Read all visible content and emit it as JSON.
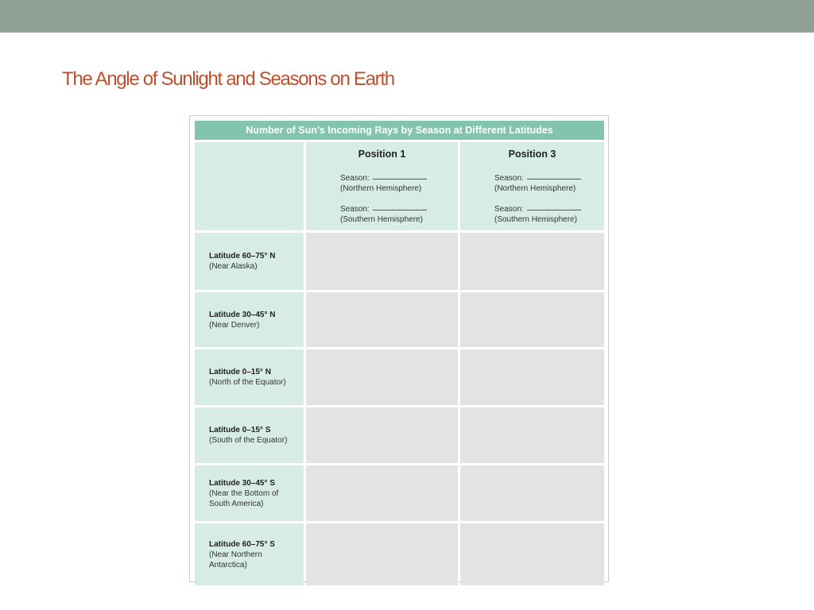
{
  "slide": {
    "title": "The Angle of Sunlight and Seasons on Earth"
  },
  "table": {
    "heading": "Number of Sun’s Incoming Rays by Season at Different Latitudes",
    "positions": [
      {
        "label": "Position 1",
        "season_label": "Season:",
        "northern": "(Northern Hemisphere)",
        "southern": "(Southern Hemisphere)"
      },
      {
        "label": "Position 3",
        "season_label": "Season:",
        "northern": "(Northern Hemisphere)",
        "southern": "(Southern Hemisphere)"
      }
    ],
    "rows": [
      {
        "latitude": "Latitude 60–75° N",
        "place": "(Near Alaska)"
      },
      {
        "latitude": "Latitude 30–45° N",
        "place": "(Near Denver)"
      },
      {
        "latitude": "Latitude 0–15° N",
        "place": "(North of the Equator)"
      },
      {
        "latitude": "Latitude 0–15° S",
        "place": "(South of the Equator)"
      },
      {
        "latitude": "Latitude 30–45° S",
        "place": "(Near the Bottom of\nSouth America)"
      },
      {
        "latitude": "Latitude 60–75° S",
        "place": "(Near Northern\nAntarctica)"
      }
    ]
  },
  "colors": {
    "top_bar": "#8fa197",
    "title": "#c0502d",
    "table_heading": "#82c4ac",
    "label_cell": "#d6ece4",
    "data_cell": "#e2e4e3"
  }
}
